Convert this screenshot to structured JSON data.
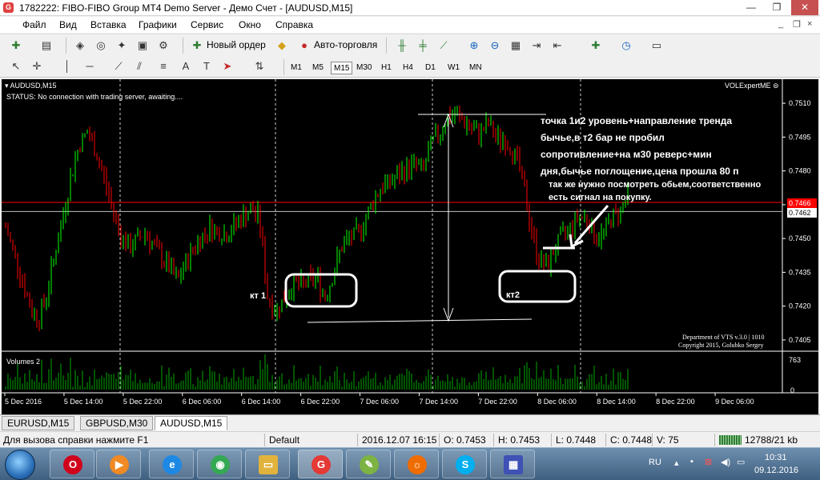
{
  "window": {
    "title": "1782222: FIBO-FIBO Group MT4 Demo Server - Демо Счет - [AUDUSD,M15]",
    "app_icon": "G",
    "minimize": "—",
    "restore": "❐",
    "close": "✕"
  },
  "menu": {
    "items": [
      "Файл",
      "Вид",
      "Вставка",
      "Графики",
      "Сервис",
      "Окно",
      "Справка"
    ],
    "mdi_minimize": "_",
    "mdi_restore": "❐",
    "mdi_close": "×"
  },
  "toolbar": {
    "new_order": "Новый ордер",
    "auto_trading": "Авто-торговля"
  },
  "timeframes": [
    "M1",
    "M5",
    "M15",
    "M30",
    "H1",
    "H4",
    "D1",
    "W1",
    "MN"
  ],
  "active_timeframe": "M15",
  "chart": {
    "symbol_label": "AUDUSD,M15",
    "status": "STATUS:   No connection with trading server, awaiting....",
    "indicator_name": "VOLExpertME",
    "volumes_label": "Volumes 2",
    "credit_line1": "Department of VTS  v.3.0 | 1010",
    "credit_line2": "Copyright 2015, Golubko Sergey",
    "annotation_lines": [
      "точка 1и2 уровень+направление тренда",
      "бычье,в т2 бар не пробил",
      "сопротивление+на м30 реверс+мин",
      "дня,бычье поглощение,цена прошла 80 п"
    ],
    "annotation2_lines": [
      "так же нужно посмотреть обьем,соответственно",
      "есть сигнал на покупку."
    ],
    "kt1": "кт 1",
    "kt2": "кт2",
    "price_red": "0.7466",
    "price_current": "0.7462",
    "volume_max": "763",
    "volume_min": "0"
  },
  "chart_data": {
    "type": "candlestick",
    "symbol": "AUDUSD",
    "timeframe": "M15",
    "y_ticks": [
      "0.7510",
      "0.7495",
      "0.7480",
      "0.7465",
      "0.7450",
      "0.7435",
      "0.7420",
      "0.7405"
    ],
    "ylim": [
      0.74,
      0.7515
    ],
    "x_ticks": [
      "5 Dec 2016",
      "5 Dec 14:00",
      "5 Dec 22:00",
      "6 Dec 06:00",
      "6 Dec 14:00",
      "6 Dec 22:00",
      "7 Dec 06:00",
      "7 Dec 14:00",
      "7 Dec 22:00",
      "8 Dec 06:00",
      "8 Dec 14:00",
      "8 Dec 22:00",
      "9 Dec 06:00"
    ],
    "horizontal_lines": [
      {
        "price": 0.7466,
        "color": "#ff0000"
      },
      {
        "price": 0.7462,
        "color": "#c0c0c0"
      }
    ],
    "close_path": [
      0.7455,
      0.7444,
      0.7432,
      0.742,
      0.7414,
      0.7425,
      0.7443,
      0.746,
      0.7478,
      0.7492,
      0.7497,
      0.7489,
      0.7477,
      0.7464,
      0.7452,
      0.7446,
      0.7449,
      0.7453,
      0.7447,
      0.7442,
      0.7437,
      0.7431,
      0.7439,
      0.7446,
      0.7451,
      0.7455,
      0.7453,
      0.7452,
      0.7456,
      0.746,
      0.7463,
      0.7459,
      0.7424,
      0.7418,
      0.7423,
      0.743,
      0.7429,
      0.7431,
      0.7433,
      0.7424,
      0.7434,
      0.7446,
      0.745,
      0.7452,
      0.7459,
      0.7468,
      0.7473,
      0.7475,
      0.7478,
      0.7481,
      0.7483,
      0.748,
      0.7492,
      0.7497,
      0.7504,
      0.7505,
      0.7502,
      0.7498,
      0.7497,
      0.7501,
      0.7494,
      0.7494,
      0.7489,
      0.7478,
      0.7458,
      0.7442,
      0.7437,
      0.7445,
      0.7451,
      0.7455,
      0.746,
      0.7459,
      0.7451,
      0.7452,
      0.7459,
      0.7462,
      0.7469
    ]
  },
  "tabs": [
    "EURUSD,M15",
    "GBPUSD,M30",
    "AUDUSD,M15"
  ],
  "active_tab": "AUDUSD,M15",
  "status": {
    "help": "Для вызова справки нажмите F1",
    "profile": "Default",
    "datetime": "2016.12.07 16:15",
    "open": "O: 0.7453",
    "high": "H: 0.7453",
    "low": "L: 0.7448",
    "close": "C: 0.7448",
    "volume": "V: 75",
    "traffic": "12788/21 kb"
  },
  "taskbar": {
    "apps": [
      {
        "name": "opera",
        "glyph": "O",
        "color": "#d0021b"
      },
      {
        "name": "media-player",
        "glyph": "▶",
        "color": "#f08a24"
      },
      {
        "name": "internet-explorer",
        "glyph": "e",
        "color": "#1e88e5"
      },
      {
        "name": "chrome",
        "glyph": "◉",
        "color": "#34a853"
      },
      {
        "name": "file-explorer",
        "glyph": "▭",
        "color": "#e2b33c"
      },
      {
        "name": "fibo-group",
        "glyph": "G",
        "color": "#e53935"
      },
      {
        "name": "paint",
        "glyph": "✎",
        "color": "#7cb342"
      },
      {
        "name": "firefox",
        "glyph": "☼",
        "color": "#ef6c00"
      },
      {
        "name": "skype",
        "glyph": "S",
        "color": "#00aff0"
      },
      {
        "name": "metatrader",
        "glyph": "▦",
        "color": "#3f51b5"
      }
    ],
    "lang": "RU",
    "time": "10:31",
    "date": "09.12.2016"
  }
}
